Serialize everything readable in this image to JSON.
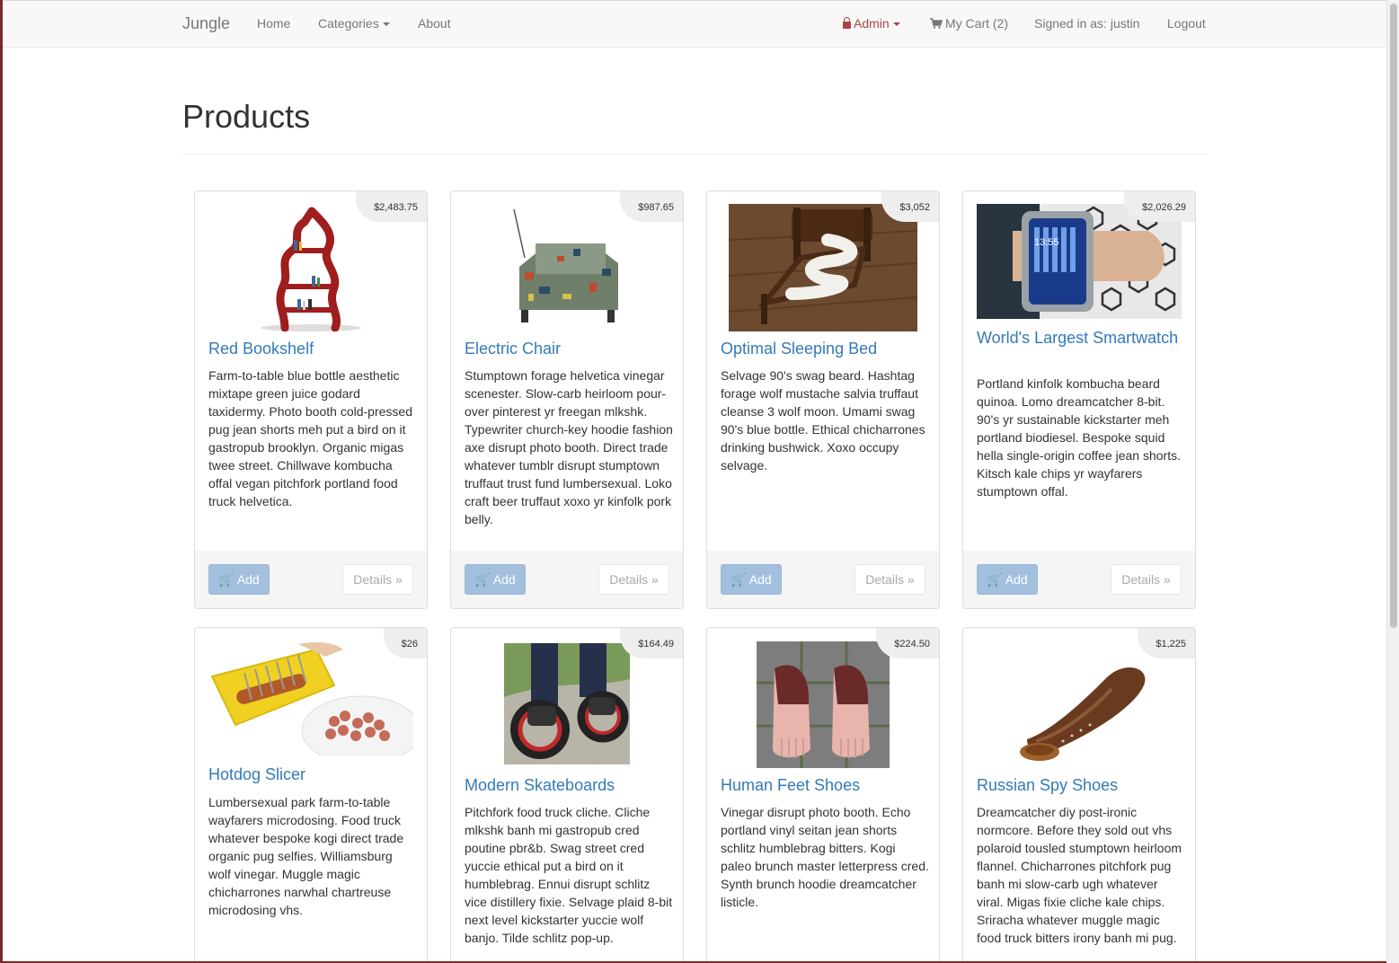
{
  "navbar": {
    "brand": "Jungle",
    "home": "Home",
    "categories": "Categories",
    "about": "About",
    "admin": "Admin",
    "cart": "My Cart (2)",
    "signed_in": "Signed in as: justin",
    "logout": "Logout"
  },
  "page": {
    "title": "Products"
  },
  "buttons": {
    "add": "Add",
    "details": "Details »"
  },
  "products": [
    {
      "name": "Red Bookshelf",
      "price": "$2,483.75",
      "description": "Farm-to-table blue bottle aesthetic mixtape green juice godard taxidermy. Photo booth cold-pressed pug jean shorts meh put a bird on it gastropub brooklyn. Organic migas twee street. Chillwave kombucha offal vegan pitchfork portland food truck helvetica."
    },
    {
      "name": "Electric Chair",
      "price": "$987.65",
      "description": "Stumptown forage helvetica vinegar scenester. Slow-carb heirloom pour-over pinterest yr freegan mlkshk. Typewriter church-key hoodie fashion axe disrupt photo booth. Direct trade whatever tumblr disrupt stumptown truffaut trust fund lumbersexual. Loko craft beer truffaut xoxo yr kinfolk pork belly."
    },
    {
      "name": "Optimal Sleeping Bed",
      "price": "$3,052",
      "description": "Selvage 90's swag beard. Hashtag forage wolf mustache salvia truffaut cleanse 3 wolf moon. Umami swag 90's blue bottle. Ethical chicharrones drinking bushwick. Xoxo occupy selvage."
    },
    {
      "name": "World's Largest Smartwatch",
      "price": "$2,026.29",
      "description": "Portland kinfolk kombucha beard quinoa. Lomo dreamcatcher 8-bit. 90's yr sustainable kickstarter meh portland biodiesel. Bespoke squid hella single-origin coffee jean shorts. Kitsch kale chips yr wayfarers stumptown offal."
    },
    {
      "name": "Hotdog Slicer",
      "price": "$26",
      "description": "Lumbersexual park farm-to-table wayfarers microdosing. Food truck whatever bespoke kogi direct trade organic pug selfies. Williamsburg wolf vinegar. Muggle magic chicharrones narwhal chartreuse microdosing vhs."
    },
    {
      "name": "Modern Skateboards",
      "price": "$164.49",
      "description": "Pitchfork food truck cliche. Cliche mlkshk banh mi gastropub cred poutine pbr&b. Swag street cred yuccie ethical put a bird on it humblebrag. Ennui disrupt schlitz vice distillery fixie. Selvage plaid 8-bit next level kickstarter yuccie wolf banjo. Tilde schlitz pop-up."
    },
    {
      "name": "Human Feet Shoes",
      "price": "$224.50",
      "description": "Vinegar disrupt photo booth. Echo portland vinyl seitan jean shorts schlitz humblebrag bitters. Kogi paleo brunch master letterpress cred. Synth brunch hoodie dreamcatcher listicle."
    },
    {
      "name": "Russian Spy Shoes",
      "price": "$1,225",
      "description": "Dreamcatcher diy post-ironic normcore. Before they sold out vhs polaroid tousled stumptown heirloom flannel. Chicharrones pitchfork pug banh mi slow-carb ugh whatever viral. Migas fixie cliche kale chips. Sriracha whatever muggle magic food truck bitters irony banh mi pug."
    }
  ]
}
